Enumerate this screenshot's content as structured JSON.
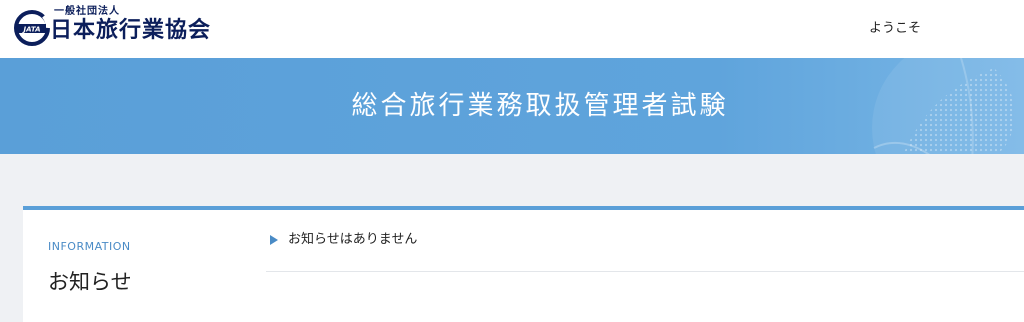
{
  "header": {
    "org_sub": "一般社団法人",
    "org_name": "日本旅行業協会",
    "logo_mark_text": "JATA",
    "welcome": "ようこそ"
  },
  "banner": {
    "title": "総合旅行業務取扱管理者試験"
  },
  "info": {
    "label": "INFORMATION",
    "heading": "お知らせ",
    "items": [
      {
        "text": "お知らせはありません"
      }
    ]
  },
  "colors": {
    "brand_navy": "#0b1e5b",
    "banner_blue": "#5a9fd8",
    "accent_blue": "#4a8bc6",
    "page_bg": "#eff1f4"
  }
}
